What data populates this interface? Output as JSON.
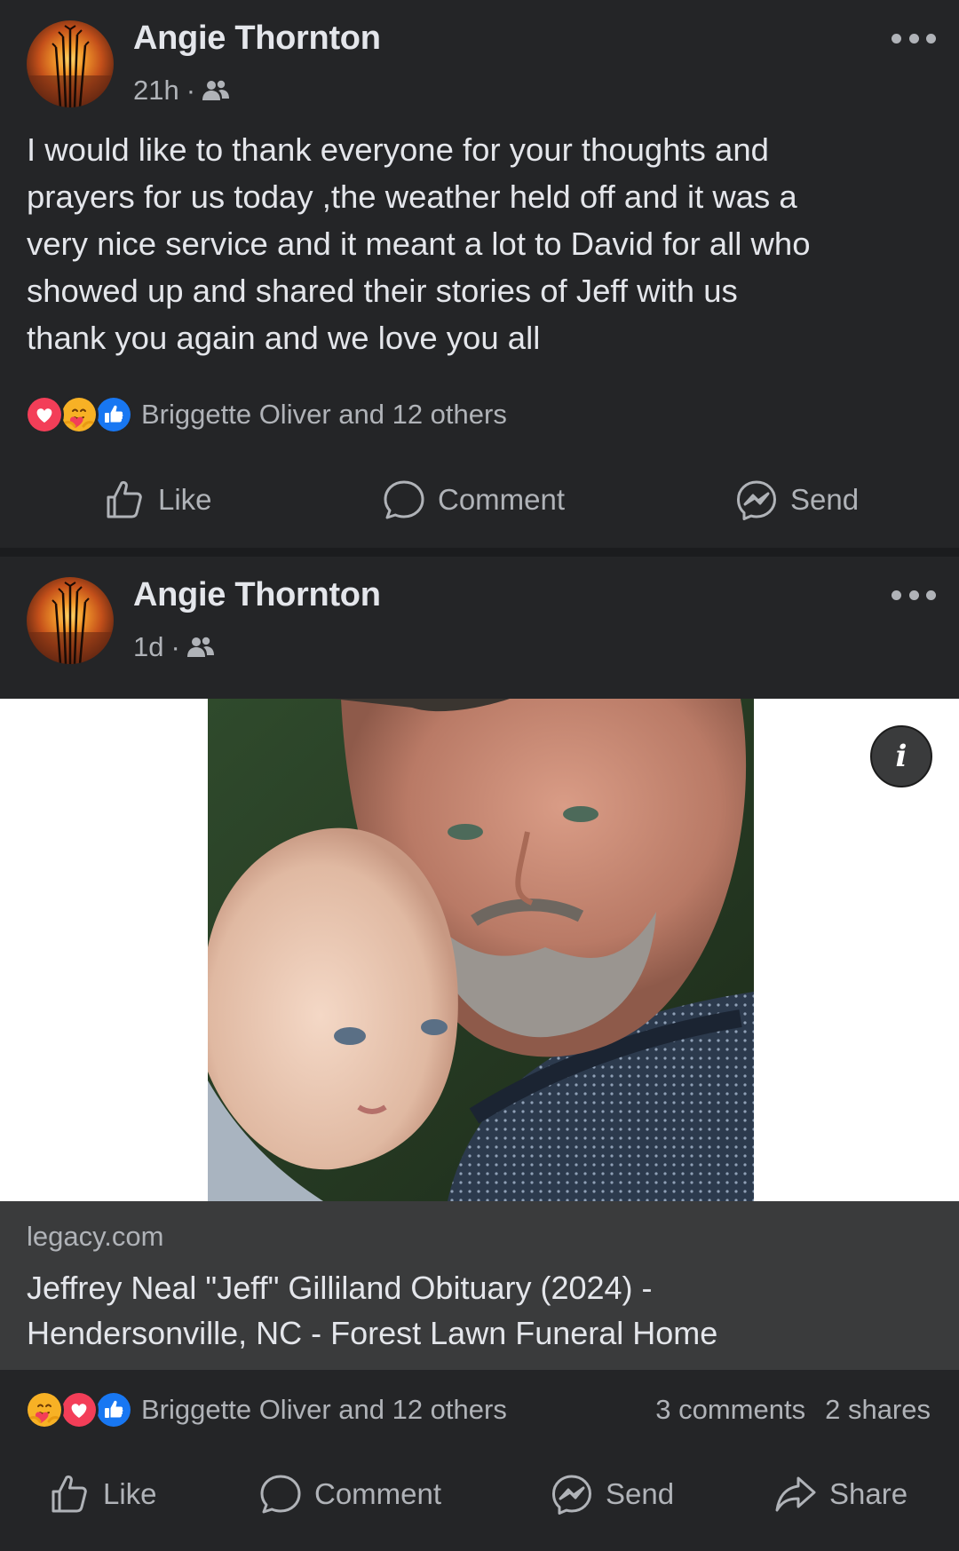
{
  "posts": [
    {
      "author": "Angie Thornton",
      "time": "21h",
      "separator": "·",
      "audience_icon": "friends-icon",
      "text": "I would like to thank everyone for your thoughts and\nprayers for us today ,the weather held off and it was a\nvery nice service and it meant a lot to David for all who\nshowed up and shared their stories of Jeff with us\nthank you again and we love you all",
      "reactions": [
        "love",
        "care",
        "like"
      ],
      "reaction_summary": "Briggette Oliver and 12 others",
      "actions": {
        "like": "Like",
        "comment": "Comment",
        "send": "Send"
      }
    },
    {
      "author": "Angie Thornton",
      "time": "1d",
      "separator": "·",
      "audience_icon": "friends-icon",
      "link": {
        "domain": "legacy.com",
        "title": "Jeffrey Neal \"Jeff\" Gilliland Obituary (2024) -\nHendersonville, NC - Forest Lawn Funeral Home",
        "info_glyph": "i"
      },
      "reactions": [
        "care",
        "love",
        "like"
      ],
      "reaction_summary": "Briggette Oliver and 12 others",
      "comments_count": "3 comments",
      "shares_count": "2 shares",
      "actions": {
        "like": "Like",
        "comment": "Comment",
        "send": "Send",
        "share": "Share"
      }
    }
  ],
  "colors": {
    "background": "#1b1c1e",
    "card": "#242527",
    "link_caption": "#3a3b3c",
    "primary_text": "#e4e6eb",
    "secondary_text": "#b0b3b8",
    "like_blue": "#1877f2",
    "love_red": "#f33e58",
    "care_yellow": "#f7b125"
  }
}
